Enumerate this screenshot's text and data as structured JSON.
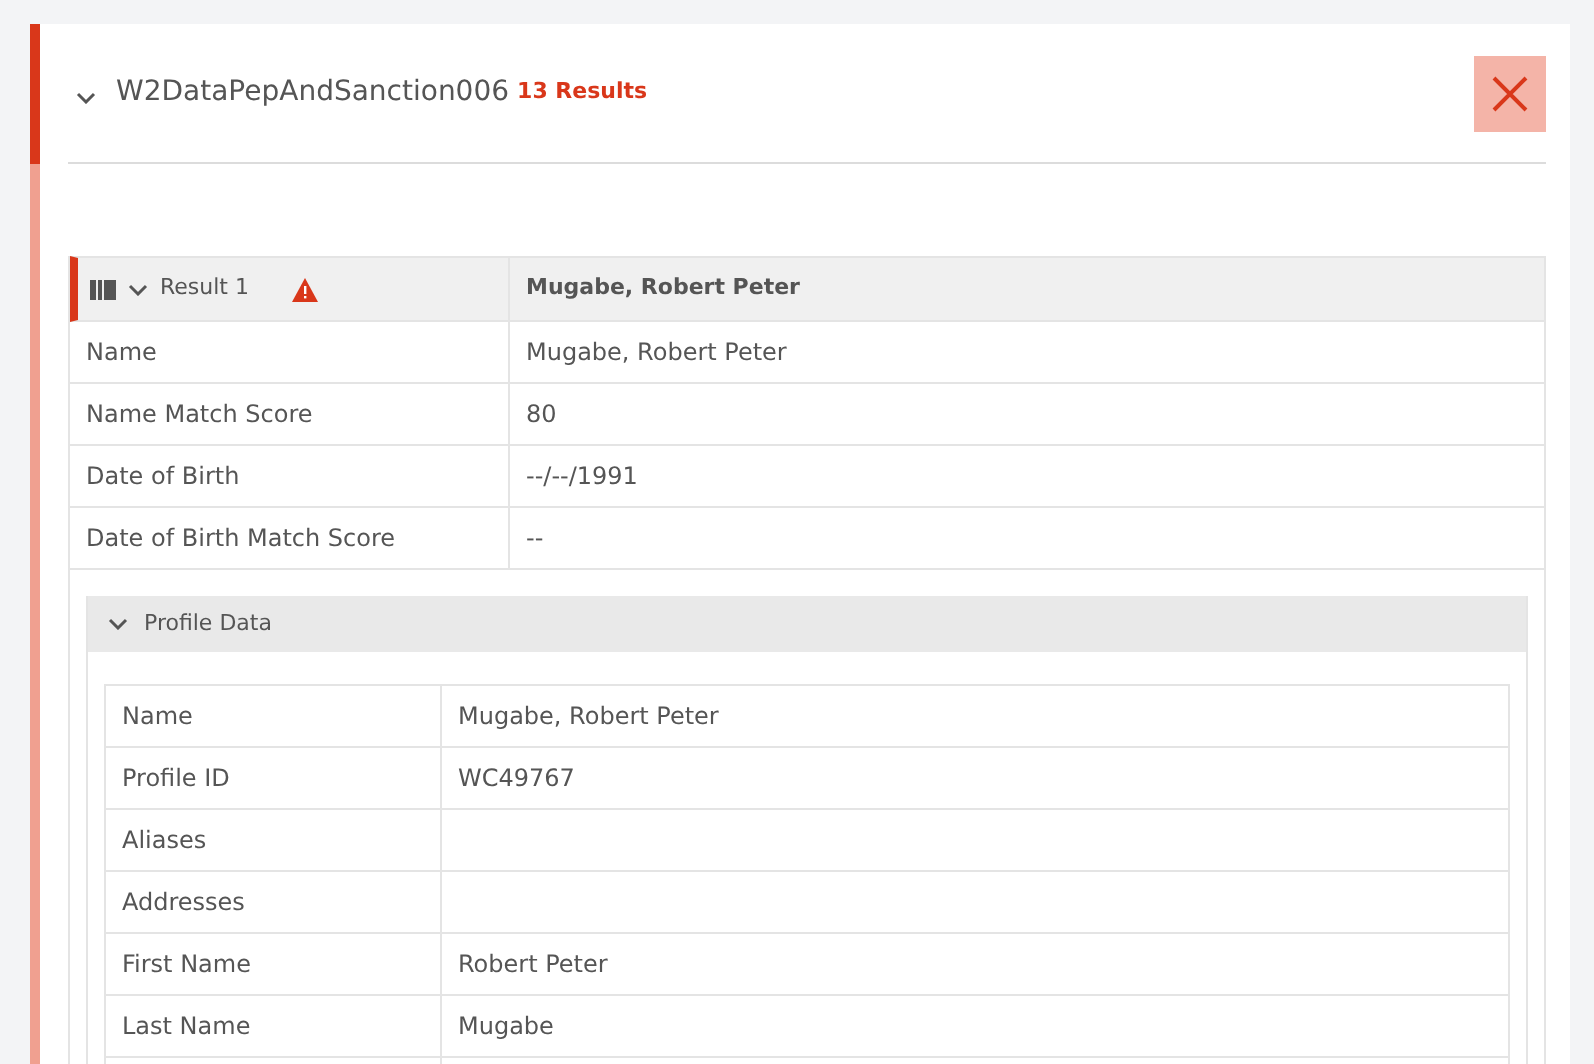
{
  "section": {
    "title": "W2DataPepAndSanction006",
    "count": "13 Results",
    "expanded": true
  },
  "result": {
    "label": "Result 1",
    "name": "Mugabe, Robert Peter",
    "warning": true,
    "expanded": true,
    "rows": [
      {
        "field": "Name",
        "value": "Mugabe, Robert Peter"
      },
      {
        "field": "Name Match Score",
        "value": "80"
      },
      {
        "field": "Date of Birth",
        "value": "--/--/1991"
      },
      {
        "field": "Date of Birth Match Score",
        "value": "--"
      }
    ]
  },
  "profile": {
    "title": "Profile Data",
    "expanded": true,
    "rows": [
      {
        "field": "Name",
        "value": "Mugabe, Robert Peter"
      },
      {
        "field": "Profile ID",
        "value": "WC49767"
      },
      {
        "field": "Aliases"
      },
      {
        "field": "Addresses"
      },
      {
        "field": "First Name",
        "value": "Robert Peter"
      },
      {
        "field": "Last Name",
        "value": "Mugabe"
      }
    ]
  }
}
